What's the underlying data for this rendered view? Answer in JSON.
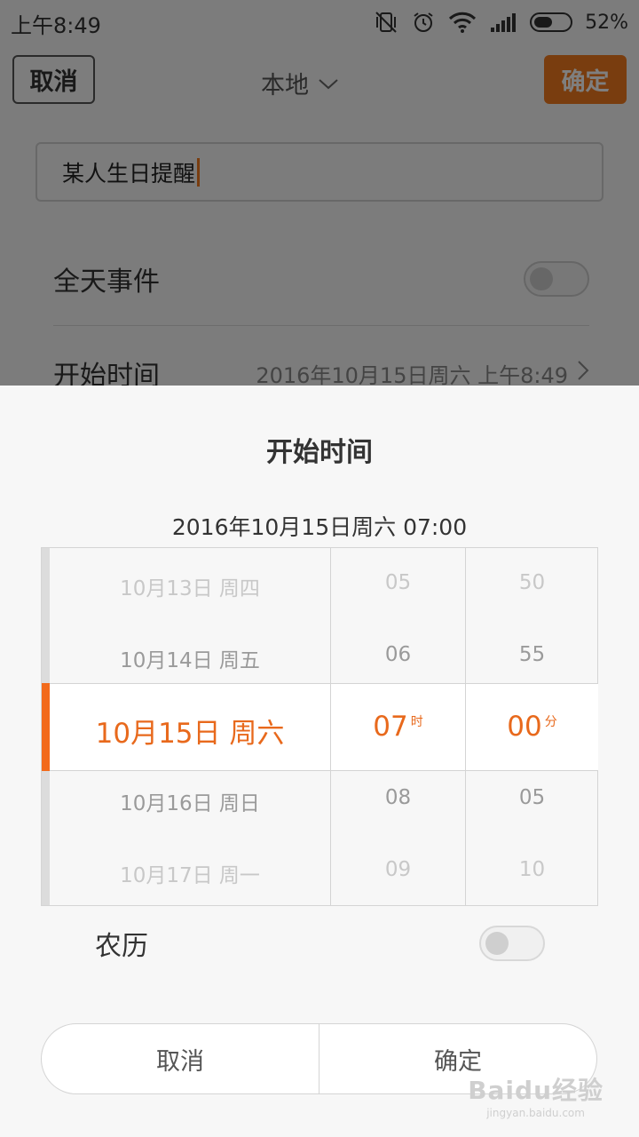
{
  "status_bar": {
    "time": "上午8:49",
    "battery_pct": "52%",
    "battery_level": 0.52
  },
  "background": {
    "cancel_label": "取消",
    "account_label": "本地",
    "confirm_label": "确定",
    "title_value": "某人生日提醒",
    "all_day_label": "全天事件",
    "all_day_on": false,
    "start_label": "开始时间",
    "start_value": "2016年10月15日周六 上午8:49"
  },
  "sheet": {
    "title": "开始时间",
    "summary": "2016年10月15日周六 07:00",
    "date_column": [
      "10月13日 周四",
      "10月14日 周五",
      "10月15日 周六",
      "10月16日 周日",
      "10月17日 周一"
    ],
    "hour_column": [
      "05",
      "06",
      "07",
      "08",
      "09"
    ],
    "minute_column": [
      "50",
      "55",
      "00",
      "05",
      "10"
    ],
    "hour_unit": "时",
    "minute_unit": "分",
    "lunar_label": "农历",
    "lunar_on": false,
    "cancel_label": "取消",
    "confirm_label": "确定"
  },
  "watermark": {
    "main": "Baidu经验",
    "sub": "jingyan.baidu.com"
  },
  "colors": {
    "accent": "#f26a1b",
    "confirm_button": "#f27a1e",
    "selected_text": "#e8691c"
  }
}
